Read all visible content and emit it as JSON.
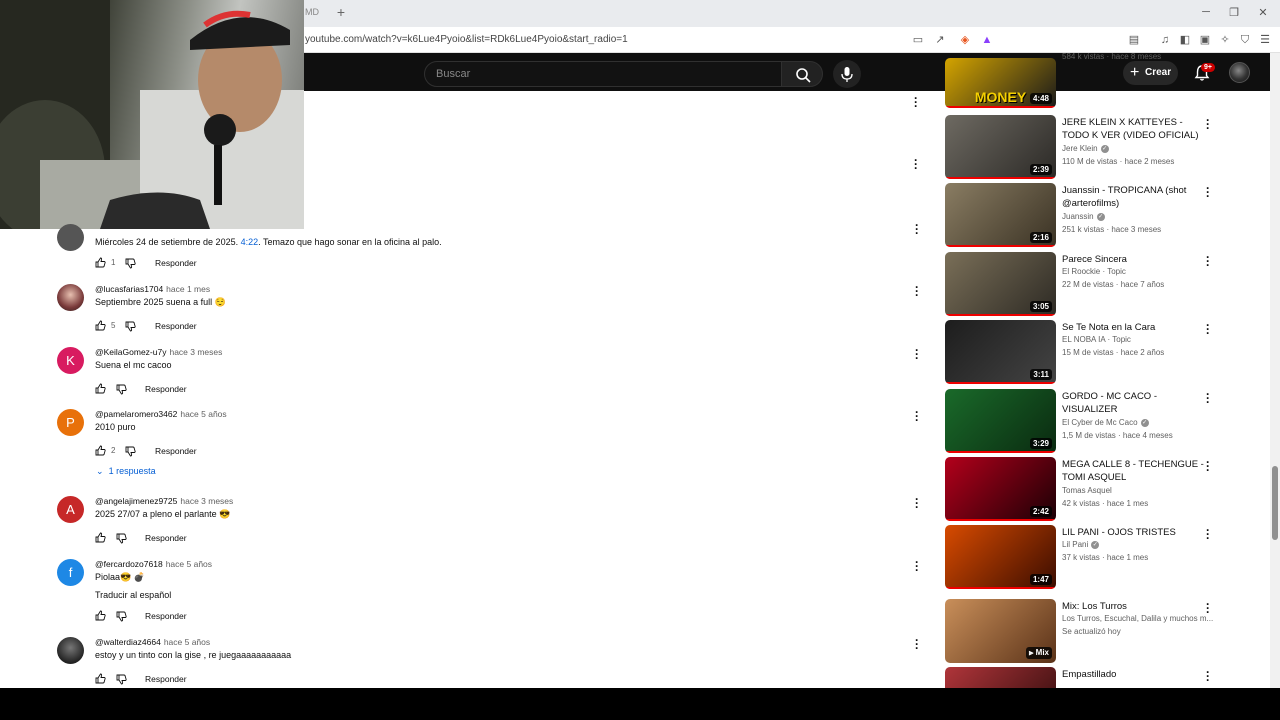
{
  "browser": {
    "tab_fragment": "MD",
    "new_tab_symbol": "+",
    "url": "youtube.com/watch?v=k6Lue4Pyoio&list=RDk6Lue4Pyoio&start_radio=1"
  },
  "header": {
    "search_placeholder": "Buscar",
    "create_label": "Crear",
    "notification_badge": "9+"
  },
  "comments": [
    {
      "author": "",
      "time": "",
      "text": "Miércoles 24 de setiembre de 2025. ",
      "timestamp": "4:22",
      "text_after": ". Temazo que hago sonar en la oficina al palo.",
      "likes": "1",
      "reply": "Responder",
      "avatar_letter": "",
      "avatar_color": "#555555"
    },
    {
      "author": "@lucasfarias1704",
      "time": "hace 1 mes",
      "text": "Septiembre 2025 suena a full 😌",
      "likes": "5",
      "reply": "Responder",
      "avatar_letter": "",
      "avatar_color": "#6b3a3a"
    },
    {
      "author": "@KeilaGomez-u7y",
      "time": "hace 3 meses",
      "text": "Suena el mc cacoo",
      "likes": "",
      "reply": "Responder",
      "avatar_letter": "K",
      "avatar_color": "#d81b60"
    },
    {
      "author": "@pamelaromero3462",
      "time": "hace 5 años",
      "text": "2010 puro",
      "likes": "2",
      "reply": "Responder",
      "avatar_letter": "P",
      "avatar_color": "#e8710a",
      "replies_label": "1 respuesta"
    },
    {
      "author": "@angelajimenez9725",
      "time": "hace 3 meses",
      "text": "2025 27/07 a pleno el parlante 😎",
      "likes": "",
      "reply": "Responder",
      "avatar_letter": "A",
      "avatar_color": "#c62828"
    },
    {
      "author": "@fercardozo7618",
      "time": "hace 5 años",
      "text": "Piolaa😎 💣",
      "translate": "Traducir al español",
      "likes": "",
      "reply": "Responder",
      "avatar_letter": "f",
      "avatar_color": "#1e88e5"
    },
    {
      "author": "@walterdiaz4664",
      "time": "hace 5 años",
      "text": "estoy y un tinto con la gise , re juegaaaaaaaaaaa",
      "likes": "",
      "reply": "Responder",
      "avatar_letter": "",
      "avatar_color": "#333333"
    }
  ],
  "sidebar": [
    {
      "title": "",
      "thumb_text": "MONEY",
      "channel": "",
      "meta": "584 k vistas · hace 8 meses",
      "duration": "4:48",
      "colors": [
        "#d4a400",
        "#1a1a1a"
      ]
    },
    {
      "title": "JERE KLEIN X KATTEYES - TODO K VER (VIDEO OFICIAL)",
      "channel": "Jere Klein",
      "verified": true,
      "meta": "110 M de vistas · hace 2 meses",
      "duration": "2:39",
      "colors": [
        "#6e6a62",
        "#2b2926"
      ]
    },
    {
      "title": "Juanssin - TROPICANA (shot @arterofilms)",
      "channel": "Juanssin",
      "verified": true,
      "meta": "251 k vistas · hace 3 meses",
      "duration": "2:16",
      "colors": [
        "#8a7d63",
        "#3a3224"
      ]
    },
    {
      "title": "Parece Sincera",
      "channel": "El Roockie · Topic",
      "meta": "22 M de vistas · hace 7 años",
      "duration": "3:05",
      "colors": [
        "#7a6f58",
        "#2d2a24"
      ]
    },
    {
      "title": "Se Te Nota en la Cara",
      "channel": "EL NOBA IA · Topic",
      "meta": "15 M de vistas · hace 2 años",
      "duration": "3:11",
      "colors": [
        "#1d1d1d",
        "#444"
      ]
    },
    {
      "title": "GORDO - MC CACO - VISUALIZER",
      "channel": "El Cyber de Mc Caco",
      "verified": true,
      "meta": "1,5 M de vistas · hace 4 meses",
      "duration": "3:29",
      "colors": [
        "#1a6a2a",
        "#0a2a10"
      ]
    },
    {
      "title": "MEGA CALLE 8 - TECHENGUE - TOMI ASQUEL",
      "channel": "Tomas Asquel",
      "meta": "42 k vistas · hace 1 mes",
      "duration": "2:42",
      "colors": [
        "#b3001b",
        "#1a0005"
      ]
    },
    {
      "title": "LIL PANI - OJOS TRISTES",
      "channel": "Lil Pani",
      "verified": true,
      "meta": "37 k vistas · hace 1 mes",
      "duration": "1:47",
      "colors": [
        "#d84b00",
        "#3a0c00"
      ]
    },
    {
      "title": "Mix: Los Turros",
      "channel": "Los Turros, Escuchal, Dalila y muchos m...",
      "meta": "Se actualizó hoy",
      "duration": "Mix",
      "colors": [
        "#c98f5a",
        "#5a3218"
      ]
    },
    {
      "title": "Empastillado",
      "channel": "",
      "meta": "",
      "duration": "",
      "colors": [
        "#b0353a",
        "#2a0a0a"
      ]
    }
  ]
}
